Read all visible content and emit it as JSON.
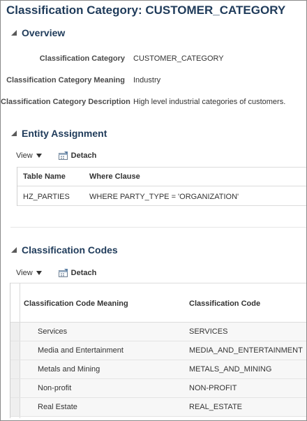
{
  "page": {
    "title": "Classification Category: CUSTOMER_CATEGORY"
  },
  "overview": {
    "title": "Overview",
    "fields": [
      {
        "label": "Classification Category",
        "value": "CUSTOMER_CATEGORY"
      },
      {
        "label": "Classification Category Meaning",
        "value": "Industry"
      },
      {
        "label": "Classification Category Description",
        "value": "High level industrial categories of customers."
      }
    ]
  },
  "entity_assignment": {
    "title": "Entity Assignment",
    "toolbar": {
      "view_label": "View",
      "detach_label": "Detach"
    },
    "columns": [
      "Table Name",
      "Where Clause"
    ],
    "rows": [
      [
        "HZ_PARTIES",
        "WHERE PARTY_TYPE = 'ORGANIZATION'"
      ]
    ]
  },
  "classification_codes": {
    "title": "Classification Codes",
    "toolbar": {
      "view_label": "View",
      "detach_label": "Detach"
    },
    "columns": [
      "Classification Code Meaning",
      "Classification Code"
    ],
    "rows": [
      [
        "Services",
        "SERVICES"
      ],
      [
        "Media and Entertainment",
        "MEDIA_AND_ENTERTAINMENT"
      ],
      [
        "Metals and Mining",
        "METALS_AND_MINING"
      ],
      [
        "Non-profit",
        "NON-PROFIT"
      ],
      [
        "Real Estate",
        "REAL_ESTATE"
      ]
    ]
  },
  "colors": {
    "title": "#1f3b5a",
    "text": "#333333",
    "border": "#8a8a8a",
    "row_bg": "#f7f7f7"
  },
  "icons": {
    "disclosure": "triangle-expanded-icon",
    "view_menu": "caret-down-icon",
    "detach": "detach-icon"
  }
}
